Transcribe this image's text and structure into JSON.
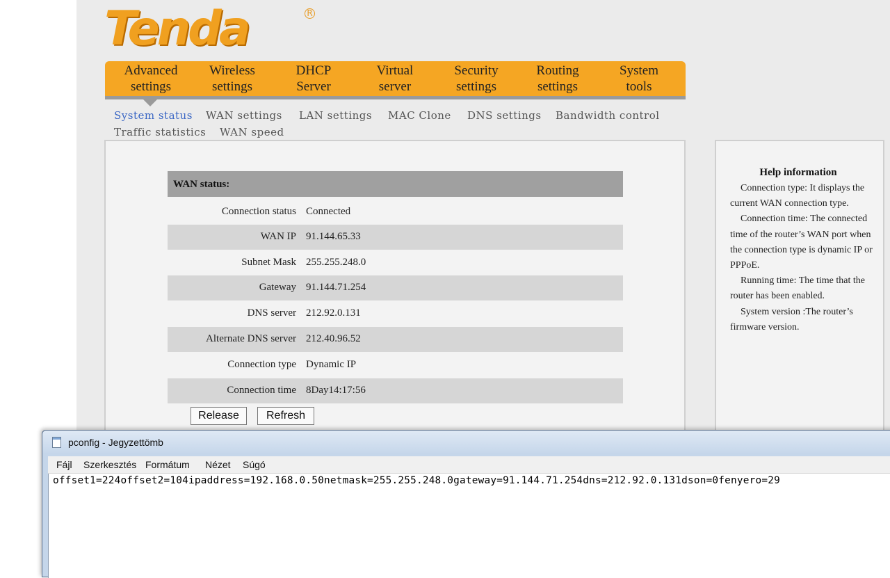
{
  "router": {
    "logo_text": "Tenda",
    "logo_reg": "R",
    "main_nav": [
      {
        "line1": "Advanced",
        "line2": "settings"
      },
      {
        "line1": "Wireless",
        "line2": "settings"
      },
      {
        "line1": "DHCP",
        "line2": "Server"
      },
      {
        "line1": "Virtual",
        "line2": "server"
      },
      {
        "line1": "Security",
        "line2": "settings"
      },
      {
        "line1": "Routing",
        "line2": "settings"
      },
      {
        "line1": "System",
        "line2": "tools"
      }
    ],
    "sub_nav": [
      "System status",
      "WAN settings",
      "LAN settings",
      "MAC Clone",
      "DNS settings",
      "Bandwidth control",
      "Traffic statistics",
      "WAN speed"
    ],
    "wan_status_title": "WAN status:",
    "rows": [
      {
        "label": "Connection status",
        "value": "Connected"
      },
      {
        "label": "WAN IP",
        "value": "91.144.65.33"
      },
      {
        "label": "Subnet Mask",
        "value": "255.255.248.0"
      },
      {
        "label": "Gateway",
        "value": "91.144.71.254"
      },
      {
        "label": "DNS server",
        "value": "212.92.0.131"
      },
      {
        "label": "Alternate DNS server",
        "value": "212.40.96.52"
      },
      {
        "label": "Connection type",
        "value": "Dynamic IP"
      },
      {
        "label": "Connection time",
        "value": "8Day14:17:56"
      }
    ],
    "buttons": {
      "release": "Release",
      "refresh": "Refresh"
    },
    "help": {
      "title": "Help information",
      "paragraphs": [
        "Connection type: It displays the current WAN connection type.",
        "Connection time: The connected time of the router’s WAN port when the connection type is dynamic IP or PPPoE.",
        "Running time: The time that the router has been enabled.",
        "System version :The router’s firmware version."
      ]
    }
  },
  "notepad": {
    "title": "pconfig - Jegyzettömb",
    "menu": [
      "Fájl",
      "Szerkesztés",
      "Formátum",
      "Nézet",
      "Súgó"
    ],
    "content": "offset1=224offset2=104ipaddress=192.168.0.50netmask=255.255.248.0gateway=91.144.71.254dns=212.92.0.131dson=0fenyero=29"
  }
}
